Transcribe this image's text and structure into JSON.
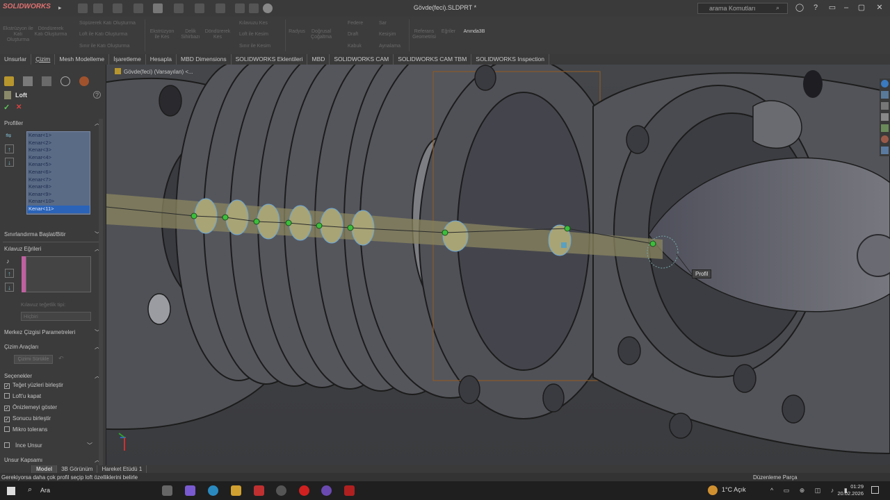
{
  "app": {
    "logo_text": "SOLIDWORKS",
    "document_title": "Gövde(feci).SLDPRT *",
    "search_placeholder": "arama Komutları"
  },
  "ribbon": {
    "items": [
      "Ekstrüzyon ile Katı Oluşturma",
      "Döndürerek Katı Oluşturma",
      "Ekstrüzyon ile Kes",
      "Delik Sihirbazı",
      "Döndürerek Kes",
      "Radyus",
      "Doğrusal Çoğaltma",
      "Referans Geometrisi",
      "Eğriler",
      "Anında3B"
    ],
    "small_items": [
      "Süpürerek Katı Oluşturma",
      "Loft ile Katı Oluşturma",
      "Sınır ile Katı Oluşturma",
      "Kılavuzu Kes",
      "Loft ile Kesim",
      "Sınır ile Kesim",
      "Federe",
      "Draft",
      "Kabuk",
      "Sar",
      "Kesişim",
      "Aynalama"
    ]
  },
  "tabs": [
    "Unsurlar",
    "Çizim",
    "Mesh Modelleme",
    "İşaretleme",
    "Hesapla",
    "MBD Dimensions",
    "SOLIDWORKS Eklentileri",
    "MBD",
    "SOLIDWORKS CAM",
    "SOLIDWORKS CAM TBM",
    "SOLIDWORKS Inspection"
  ],
  "panel": {
    "feature_title": "Loft",
    "ok_symbol": "✓",
    "cancel_symbol": "✕",
    "help_symbol": "?",
    "profiles_header": "Profiller",
    "profiles": [
      "Kenar<1>",
      "Kenar<2>",
      "Kenar<3>",
      "Kenar<4>",
      "Kenar<5>",
      "Kenar<6>",
      "Kenar<7>",
      "Kenar<8>",
      "Kenar<9>",
      "Kenar<10>",
      "Kenar<11>"
    ],
    "selected_profile_index": 10,
    "constraints_header": "Sınırlandırma Başlat/Bitir",
    "guides_header": "Kılavuz Eğrileri",
    "guide_tangency_label": "Kılavuz teğetlik tipi:",
    "guide_tangency_value": "Hiçbiri",
    "centerline_header": "Merkez Çizgisi Parametreleri",
    "sketch_tools_header": "Çizim Araçları",
    "sketch_drag_label": "Çizimi Sürükle",
    "options_header": "Seçenekler",
    "options": [
      {
        "label": "Teğet yüzleri birleştir",
        "checked": true
      },
      {
        "label": "Loft'u kapat",
        "checked": false
      },
      {
        "label": "Önizlemeyi göster",
        "checked": true
      },
      {
        "label": "Sonucu birleştir",
        "checked": true
      },
      {
        "label": "Mikro tolerans",
        "checked": false
      }
    ],
    "thin_feature_label": "İnce Unsur",
    "thin_feature_checked": false,
    "feature_scope_header": "Unsur Kapsamı"
  },
  "viewport": {
    "breadcrumb": "Gövde(feci) (Varsayılan) <...",
    "callout_label": "Profil"
  },
  "bottom_tabs": [
    "Model",
    "3B Görünüm",
    "Hareket Etüdü 1"
  ],
  "status": {
    "message": "Gerekiyorsa daha çok profil seçip loft özelliklerini belirle",
    "mode": "Düzenleme Parça"
  },
  "taskbar": {
    "search_label": "Ara",
    "weather": "1°C  Açık",
    "time": "01:29",
    "date": "20.02.2026"
  },
  "colors": {
    "accent_selection": "#2a63b8",
    "loft_preview": "#b8b27a",
    "profile_point": "#3cbf3c",
    "ok_green": "#5cc85c",
    "cancel_red": "#e04040"
  }
}
